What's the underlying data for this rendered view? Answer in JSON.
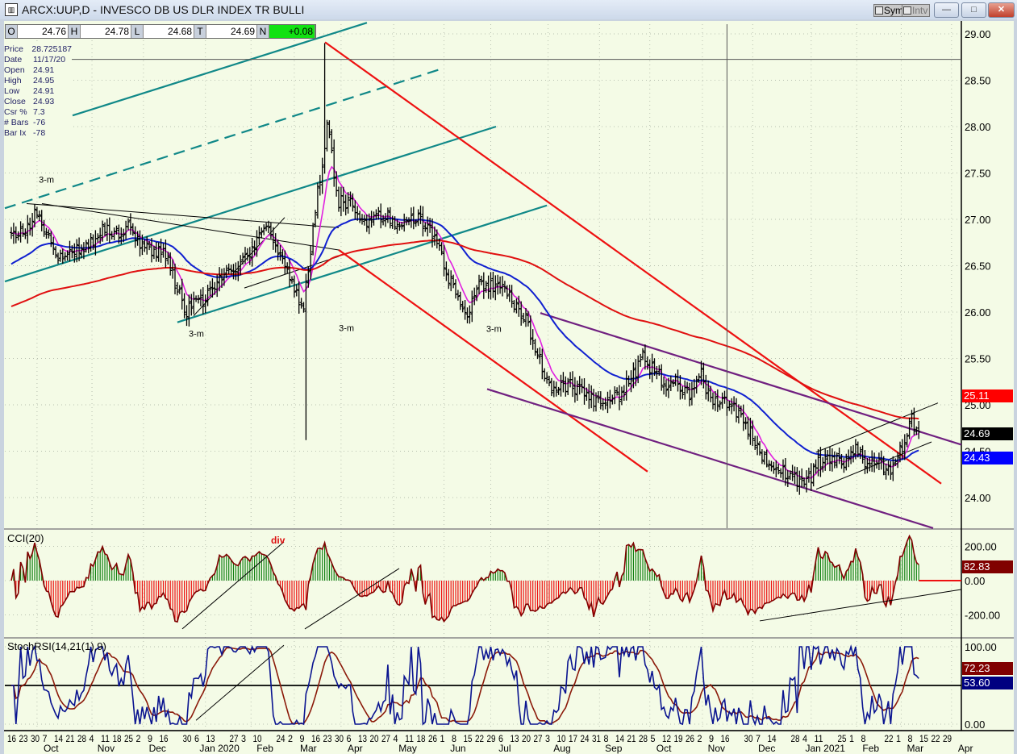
{
  "window": {
    "title": "ARCX:UUP,D - INVESCO DB US DLR INDEX TR BULLI",
    "sym_label": "Sym",
    "intv_label": "Intv",
    "minimize_glyph": "—",
    "maximize_glyph": "□",
    "close_glyph": "✕"
  },
  "ohlc_bar": {
    "o_label": "O",
    "o": "24.76",
    "h_label": "H",
    "h": "24.78",
    "l_label": "L",
    "l": "24.68",
    "t_label": "T",
    "t": "24.69",
    "n_label": "N",
    "n": "+0.08"
  },
  "data_box": [
    {
      "k": "Price",
      "v": "28.725187"
    },
    {
      "k": "Date",
      "v": "11/17/20"
    },
    {
      "k": "Open",
      "v": "24.91"
    },
    {
      "k": "High",
      "v": "24.95"
    },
    {
      "k": "Low",
      "v": "24.91"
    },
    {
      "k": "Close",
      "v": "24.93"
    },
    {
      "k": "Csr %",
      "v": "7.3"
    },
    {
      "k": "# Bars",
      "v": "-76"
    },
    {
      "k": "Bar Ix",
      "v": "-78"
    }
  ],
  "value_labels": {
    "ma_red": {
      "text": "25.11",
      "color": "#ff0000"
    },
    "last": {
      "text": "24.69",
      "color": "#000000"
    },
    "ma_blue": {
      "text": "24.43",
      "color": "#0000ff"
    },
    "cci": {
      "text": "82.83",
      "color": "#800000"
    },
    "stoch_signal": {
      "text": "72.23",
      "color": "#800000"
    },
    "stoch_k": {
      "text": "53.60",
      "color": "#000080"
    }
  },
  "chart_data": {
    "type": "line",
    "title": "ARCX:UUP,D - INVESCO DB US DLR INDEX TR BULLI",
    "price_panel": {
      "ylim": [
        23.7,
        29.1
      ],
      "ticks": [
        "29.00",
        "28.50",
        "28.00",
        "27.50",
        "27.00",
        "26.50",
        "26.00",
        "25.50",
        "25.00",
        "24.50",
        "24.00"
      ],
      "tick_values": [
        29,
        28.5,
        28,
        27.5,
        27,
        26.5,
        26,
        25.5,
        25,
        24.5,
        24
      ],
      "x_unit": "weeks since 2019-09-16",
      "weekly_close": [
        26.8,
        26.85,
        27.05,
        26.9,
        26.6,
        26.7,
        26.63,
        26.8,
        26.9,
        26.85,
        26.95,
        26.75,
        26.65,
        26.7,
        26.3,
        26.0,
        26.1,
        26.2,
        26.35,
        26.45,
        26.55,
        26.75,
        26.95,
        26.6,
        26.3,
        26.05,
        27.1,
        28.0,
        27.2,
        27.15,
        26.97,
        27.05,
        27.05,
        26.97,
        27.05,
        27.0,
        26.85,
        26.5,
        26.2,
        26.0,
        26.28,
        26.28,
        26.23,
        26.1,
        25.93,
        25.54,
        25.2,
        25.23,
        25.2,
        25.1,
        25.0,
        25.06,
        25.1,
        25.28,
        25.5,
        25.37,
        25.2,
        25.23,
        25.1,
        25.32,
        25.0,
        25.06,
        24.93,
        24.76,
        24.45,
        24.4,
        24.28,
        24.2,
        24.15,
        24.37,
        24.4,
        24.37,
        24.54,
        24.4,
        24.37,
        24.28,
        24.5,
        24.84,
        24.69
      ],
      "extremes": [
        {
          "week": 25.2,
          "low": 24.62
        },
        {
          "week": 26.8,
          "high": 28.9
        }
      ],
      "moving_averages": [
        {
          "name": "fast",
          "color": "#e020e0",
          "period": 8
        },
        {
          "name": "mid",
          "color": "#1020d0",
          "period": 40
        },
        {
          "name": "slow",
          "color": "#e01010",
          "period": 150
        }
      ],
      "crosshair": {
        "price": 28.725187,
        "week": 61.2
      },
      "trendlines": [
        {
          "color": "#108888",
          "dash": false,
          "p": [
            [
              5.24,
              28.12
            ],
            [
              30.41,
              29.12
            ]
          ]
        },
        {
          "color": "#108888",
          "dash": true,
          "p": [
            [
              -0.55,
              27.12
            ],
            [
              36.97,
              28.63
            ]
          ]
        },
        {
          "color": "#108888",
          "dash": false,
          "p": [
            [
              -0.55,
              26.33
            ],
            [
              41.45,
              28.0
            ]
          ]
        },
        {
          "color": "#108888",
          "dash": false,
          "p": [
            [
              14.2,
              25.89
            ],
            [
              45.8,
              27.15
            ]
          ]
        },
        {
          "color": "#000000",
          "dash": false,
          "thin": true,
          "p": [
            [
              1.31,
              27.17
            ],
            [
              28.0,
              26.91
            ]
          ]
        },
        {
          "color": "#000000",
          "dash": false,
          "thin": true,
          "p": [
            [
              2.62,
              27.17
            ],
            [
              28.0,
              26.67
            ]
          ]
        },
        {
          "color": "#000000",
          "dash": false,
          "thin": true,
          "p": [
            [
              15.59,
              25.96
            ],
            [
              23.38,
              27.02
            ]
          ]
        },
        {
          "color": "#000000",
          "dash": false,
          "thin": true,
          "p": [
            [
              19.93,
              26.26
            ],
            [
              28.0,
              26.6
            ]
          ]
        },
        {
          "color": "#ee1111",
          "dash": false,
          "p": [
            [
              26.83,
              28.91
            ],
            [
              79.52,
              24.15
            ]
          ]
        },
        {
          "color": "#ee1111",
          "dash": false,
          "p": [
            [
              28.0,
              26.67
            ],
            [
              54.41,
              24.28
            ]
          ]
        },
        {
          "color": "#702080",
          "dash": false,
          "p": [
            [
              45.24,
              25.99
            ],
            [
              81.24,
              24.57
            ]
          ]
        },
        {
          "color": "#702080",
          "dash": false,
          "p": [
            [
              40.69,
              25.17
            ],
            [
              78.83,
              23.67
            ]
          ]
        },
        {
          "color": "#000000",
          "dash": false,
          "thin": true,
          "p": [
            [
              68.83,
              24.49
            ],
            [
              79.24,
              25.02
            ]
          ]
        },
        {
          "color": "#000000",
          "dash": false,
          "thin": true,
          "p": [
            [
              68.83,
              24.09
            ],
            [
              78.69,
              24.6
            ]
          ]
        }
      ],
      "annotations": [
        {
          "text": "3-m",
          "week": 3.04,
          "price": 27.43
        },
        {
          "text": "3-m",
          "week": 15.86,
          "price": 25.77
        },
        {
          "text": "3-m",
          "week": 28.7,
          "price": 25.83
        },
        {
          "text": "3-m",
          "week": 41.3,
          "price": 25.82
        }
      ]
    },
    "cci_panel": {
      "title": "CCI(20)",
      "period": 20,
      "ylim": [
        -300,
        300
      ],
      "ticks": [
        "200.00",
        "0.00",
        "-200.00"
      ],
      "tick_values": [
        200,
        0,
        -200
      ],
      "annotation": {
        "text": "div",
        "week": 22.9,
        "value": 235
      },
      "trendlines": [
        {
          "p": [
            [
              14.62,
              -282
            ],
            [
              23.31,
              226
            ]
          ]
        },
        {
          "p": [
            [
              25.1,
              -282
            ],
            [
              33.17,
              71
            ]
          ]
        },
        {
          "p": [
            [
              64,
              -235
            ],
            [
              81.24,
              -52
            ]
          ]
        }
      ]
    },
    "stoch_panel": {
      "title": "StochRSI(14,21(1),9)",
      "ylim": [
        -5,
        105
      ],
      "ticks": [
        "100.00",
        "0.00"
      ],
      "tick_values": [
        100,
        0
      ],
      "midline": 50,
      "trendlines": [
        {
          "p": [
            [
              15.8,
              5
            ],
            [
              23.31,
              102
            ]
          ]
        }
      ]
    },
    "x_axis": {
      "day_labels": [
        {
          "t": "16",
          "w": 0
        },
        {
          "t": "23",
          "w": 1
        },
        {
          "t": "30",
          "w": 2
        },
        {
          "t": "7",
          "w": 3
        },
        {
          "t": "14",
          "w": 4
        },
        {
          "t": "21",
          "w": 5
        },
        {
          "t": "28",
          "w": 6
        },
        {
          "t": "4",
          "w": 7
        },
        {
          "t": "11",
          "w": 8
        },
        {
          "t": "18",
          "w": 9
        },
        {
          "t": "25",
          "w": 10
        },
        {
          "t": "2",
          "w": 11
        },
        {
          "t": "9",
          "w": 12
        },
        {
          "t": "16",
          "w": 13
        },
        {
          "t": "30",
          "w": 15
        },
        {
          "t": "6",
          "w": 16
        },
        {
          "t": "13",
          "w": 17
        },
        {
          "t": "27",
          "w": 19
        },
        {
          "t": "3",
          "w": 20
        },
        {
          "t": "10",
          "w": 21
        },
        {
          "t": "24",
          "w": 23
        },
        {
          "t": "2",
          "w": 24
        },
        {
          "t": "9",
          "w": 25
        },
        {
          "t": "16",
          "w": 26
        },
        {
          "t": "23",
          "w": 27
        },
        {
          "t": "30",
          "w": 28
        },
        {
          "t": "6",
          "w": 29
        },
        {
          "t": "13",
          "w": 30
        },
        {
          "t": "20",
          "w": 31
        },
        {
          "t": "27",
          "w": 32
        },
        {
          "t": "4",
          "w": 33
        },
        {
          "t": "11",
          "w": 34
        },
        {
          "t": "18",
          "w": 35
        },
        {
          "t": "26",
          "w": 36
        },
        {
          "t": "1",
          "w": 37
        },
        {
          "t": "8",
          "w": 38
        },
        {
          "t": "15",
          "w": 39
        },
        {
          "t": "22",
          "w": 40
        },
        {
          "t": "29",
          "w": 41
        },
        {
          "t": "6",
          "w": 42
        },
        {
          "t": "13",
          "w": 43
        },
        {
          "t": "20",
          "w": 44
        },
        {
          "t": "27",
          "w": 45
        },
        {
          "t": "3",
          "w": 46
        },
        {
          "t": "10",
          "w": 47
        },
        {
          "t": "17",
          "w": 48
        },
        {
          "t": "24",
          "w": 49
        },
        {
          "t": "31",
          "w": 50
        },
        {
          "t": "8",
          "w": 51
        },
        {
          "t": "14",
          "w": 52
        },
        {
          "t": "21",
          "w": 53
        },
        {
          "t": "28",
          "w": 54
        },
        {
          "t": "5",
          "w": 55
        },
        {
          "t": "12",
          "w": 56
        },
        {
          "t": "19",
          "w": 57
        },
        {
          "t": "26",
          "w": 58
        },
        {
          "t": "2",
          "w": 59
        },
        {
          "t": "9",
          "w": 60
        },
        {
          "t": "16",
          "w": 61
        },
        {
          "t": "30",
          "w": 63
        },
        {
          "t": "7",
          "w": 64
        },
        {
          "t": "14",
          "w": 65
        },
        {
          "t": "28",
          "w": 67
        },
        {
          "t": "4",
          "w": 68
        },
        {
          "t": "11",
          "w": 69
        },
        {
          "t": "25",
          "w": 71
        },
        {
          "t": "1",
          "w": 72
        },
        {
          "t": "8",
          "w": 73
        },
        {
          "t": "22",
          "w": 75
        },
        {
          "t": "1",
          "w": 76
        },
        {
          "t": "8",
          "w": 77
        },
        {
          "t": "15",
          "w": 78
        },
        {
          "t": "22",
          "w": 79
        },
        {
          "t": "29",
          "w": 80
        }
      ],
      "month_labels": [
        {
          "t": "Oct",
          "w": 3.4
        },
        {
          "t": "Nov",
          "w": 8.1
        },
        {
          "t": "Dec",
          "w": 12.5
        },
        {
          "t": "Jan 2020",
          "w": 17.8
        },
        {
          "t": "Feb",
          "w": 21.7
        },
        {
          "t": "Mar",
          "w": 25.4
        },
        {
          "t": "Apr",
          "w": 29.4
        },
        {
          "t": "May",
          "w": 33.9
        },
        {
          "t": "Jun",
          "w": 38.2
        },
        {
          "t": "Jul",
          "w": 42.2
        },
        {
          "t": "Aug",
          "w": 47.1
        },
        {
          "t": "Sep",
          "w": 51.5
        },
        {
          "t": "Oct",
          "w": 55.8
        },
        {
          "t": "Nov",
          "w": 60.3
        },
        {
          "t": "Dec",
          "w": 64.6
        },
        {
          "t": "Jan 2021",
          "w": 69.6
        },
        {
          "t": "Feb",
          "w": 73.5
        },
        {
          "t": "Mar",
          "w": 77.3
        },
        {
          "t": "Apr",
          "w": 81.6
        }
      ]
    }
  }
}
